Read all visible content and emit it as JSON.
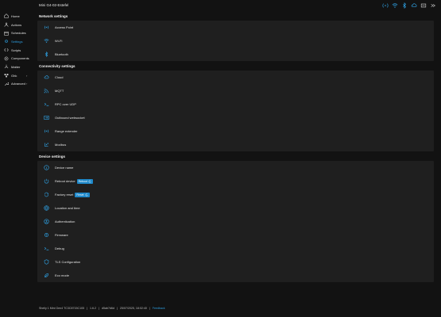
{
  "header": {
    "device_title": "Mini G4-02-Estefel",
    "status_icons": [
      "wifi-ap-icon",
      "wifi-icon",
      "bluetooth-icon",
      "cloud-icon",
      "outbound-icon",
      "rpc-icon"
    ]
  },
  "sidebar": {
    "items": [
      {
        "label": "Home",
        "icon": "home-icon",
        "active": false
      },
      {
        "label": "Actions",
        "icon": "actions-icon",
        "active": false
      },
      {
        "label": "Schedules",
        "icon": "calendar-icon",
        "active": false
      },
      {
        "label": "Settings",
        "icon": "gear-icon",
        "active": true
      },
      {
        "label": "Scripts",
        "icon": "code-icon",
        "active": false
      },
      {
        "label": "Components",
        "icon": "components-icon",
        "active": false
      },
      {
        "label": "Matter",
        "icon": "matter-icon",
        "active": false
      },
      {
        "label": "Ghk",
        "icon": "ghk-icon",
        "active": false,
        "chevron": "›"
      },
      {
        "label": "Advanced",
        "icon": "wrench-icon",
        "active": false,
        "chevron": "›"
      }
    ]
  },
  "sections": {
    "network": {
      "title": "Network settings",
      "rows": [
        {
          "label": "Access Point",
          "icon": "access-point-icon"
        },
        {
          "label": "Wi-Fi",
          "icon": "wifi-icon"
        },
        {
          "label": "Bluetooth",
          "icon": "bluetooth-icon"
        }
      ]
    },
    "connectivity": {
      "title": "Connectivity settings",
      "rows": [
        {
          "label": "Cloud",
          "icon": "cloud-icon"
        },
        {
          "label": "MQTT",
          "icon": "mqtt-icon"
        },
        {
          "label": "RPC over UDP",
          "icon": "terminal-icon"
        },
        {
          "label": "Outbound websocket",
          "icon": "websocket-icon"
        },
        {
          "label": "Range extender",
          "icon": "range-extender-icon"
        },
        {
          "label": "Modbus",
          "icon": "modbus-icon"
        }
      ]
    },
    "device": {
      "title": "Device settings",
      "rows": [
        {
          "label": "Device name",
          "icon": "info-icon"
        },
        {
          "label": "Reboot device",
          "icon": "power-icon",
          "badge": "Reboot"
        },
        {
          "label": "Factory reset",
          "icon": "reset-icon",
          "badge": "Reset"
        },
        {
          "label": "Location and time",
          "icon": "globe-icon"
        },
        {
          "label": "Authentication",
          "icon": "user-icon"
        },
        {
          "label": "Firmware",
          "icon": "firmware-icon"
        },
        {
          "label": "Debug",
          "icon": "terminal-icon"
        },
        {
          "label": "TLS Configuration",
          "icon": "shield-icon"
        },
        {
          "label": "Eco mode",
          "icon": "eco-icon"
        }
      ]
    }
  },
  "footer": {
    "model": "Shelly 1 Mini Gen4 TC3C8715C105",
    "version": "1.6.2",
    "build": "d5ab7d6d",
    "date": "25/07/2025, 18:02:40",
    "link": "Feedback"
  },
  "colors": {
    "accent": "#2e9fe0",
    "background": "#121212",
    "card": "#1f1f1f"
  }
}
